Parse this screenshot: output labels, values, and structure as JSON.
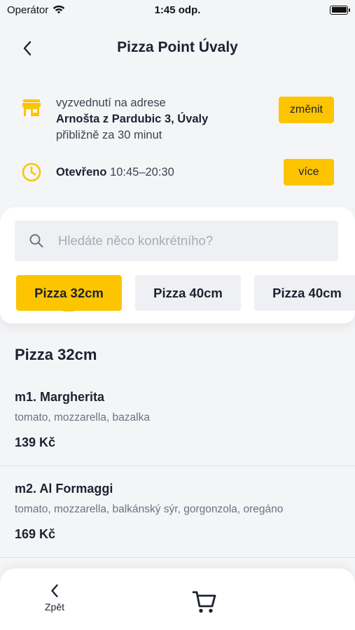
{
  "status_bar": {
    "carrier": "Operátor",
    "time": "1:45 odp."
  },
  "header": {
    "title": "Pizza Point Úvaly",
    "back_icon": "chevron-left-icon"
  },
  "pickup": {
    "icon": "store-icon",
    "line1": "vyzvednutí na adrese",
    "address": "Arnošta z Pardubic 3, Úvaly",
    "eta": "přibližně za 30 minut",
    "change_label": "změnit"
  },
  "hours": {
    "icon": "clock-icon",
    "status": "Otevřeno",
    "time_range": "10:45–20:30",
    "more_label": "více"
  },
  "search": {
    "icon": "search-icon",
    "placeholder": "Hledáte něco konkrétního?"
  },
  "tabs": [
    {
      "label": "Pizza 32cm",
      "active": true
    },
    {
      "label": "Pizza 40cm",
      "active": false
    },
    {
      "label": "Pizza 40cm",
      "active": false
    }
  ],
  "section": {
    "title": "Pizza 32cm"
  },
  "items": [
    {
      "name": "m1. Margherita",
      "description": "tomato, mozzarella, bazalka",
      "price": "139 Kč"
    },
    {
      "name": "m2. Al Formaggi",
      "description": "tomato, mozzarella, balkánský sýr, gorgonzola, oregáno",
      "price": "169 Kč"
    }
  ],
  "bottom_bar": {
    "back_label": "Zpět",
    "back_icon": "chevron-left-icon",
    "cart_icon": "cart-icon"
  },
  "colors": {
    "accent": "#fdc400",
    "text_dark": "#1c2230",
    "background": "#f4f5f7"
  }
}
